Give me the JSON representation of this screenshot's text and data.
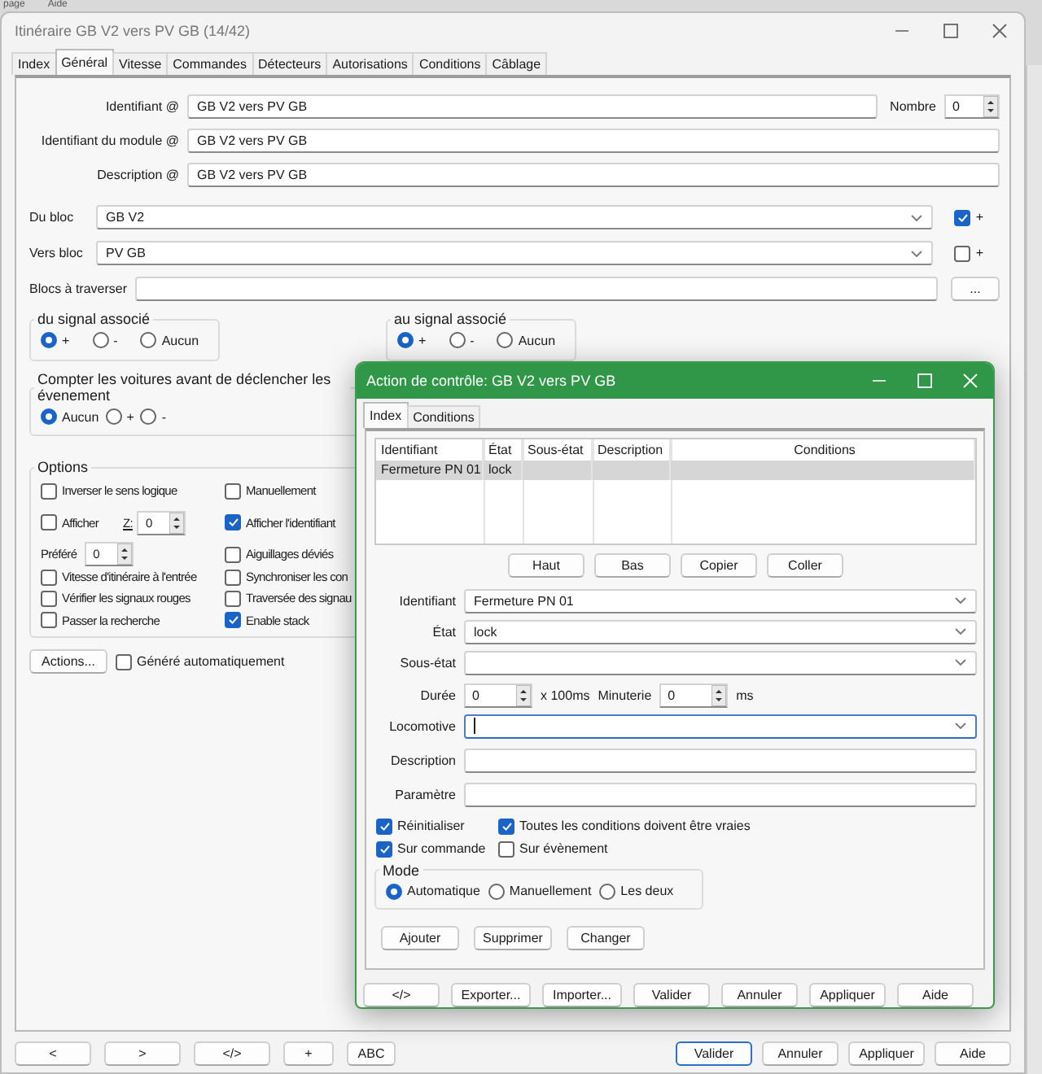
{
  "background_menu": [
    {
      "label": "page"
    },
    {
      "label": "Aide"
    }
  ],
  "window": {
    "title": "Itinéraire GB V2 vers PV GB (14/42)"
  },
  "tabs": [
    {
      "label": "Index",
      "selected": false
    },
    {
      "label": "Général",
      "selected": true
    },
    {
      "label": "Vitesse",
      "selected": false
    },
    {
      "label": "Commandes",
      "selected": false
    },
    {
      "label": "Détecteurs",
      "selected": false
    },
    {
      "label": "Autorisations",
      "selected": false
    },
    {
      "label": "Conditions",
      "selected": false
    },
    {
      "label": "Câblage",
      "selected": false
    }
  ],
  "identity_fields": [
    {
      "label": "Identifiant @",
      "value": "GB V2 vers PV GB"
    },
    {
      "label": "Identifiant du module @",
      "value": "GB V2 vers PV GB"
    },
    {
      "label": "Description @",
      "value": "GB V2 vers PV GB"
    }
  ],
  "nombre": {
    "label": "Nombre",
    "value": "0"
  },
  "block_fields": [
    {
      "label": "Du bloc",
      "value": "GB V2",
      "plus_label": "+",
      "checked": true
    },
    {
      "label": "Vers bloc",
      "value": "PV GB",
      "plus_label": "+",
      "checked": false
    }
  ],
  "blocs_a_traverser": {
    "label": "Blocs à traverser",
    "button": "..."
  },
  "signal_groups": [
    {
      "title": "du signal associé",
      "options": [
        {
          "label": "+",
          "selected": true
        },
        {
          "label": "-",
          "selected": false
        },
        {
          "label": "Aucun",
          "selected": false
        }
      ]
    },
    {
      "title": "au signal associé",
      "options": [
        {
          "label": "+",
          "selected": true
        },
        {
          "label": "-",
          "selected": false
        },
        {
          "label": "Aucun",
          "selected": false
        }
      ]
    }
  ],
  "count_group": {
    "title": "Compter les voitures avant de déclencher les évenement",
    "options": [
      {
        "label": "Aucun",
        "selected": true
      },
      {
        "label": "+",
        "selected": false
      },
      {
        "label": "-",
        "selected": false
      }
    ]
  },
  "options": {
    "title": "Options",
    "items": [
      {
        "kind": "checkbox",
        "label": "Inverser le sens logique",
        "checked": false
      },
      {
        "kind": "checkbox",
        "label": "Manuellement",
        "checked": false
      },
      {
        "kind": "checkbox_spin",
        "label": "Afficher",
        "checked": false,
        "spin_label": "Z:",
        "value": "0"
      },
      {
        "kind": "checkbox",
        "label": "Afficher l'identifiant",
        "checked": true
      },
      {
        "kind": "spin",
        "label": "Préféré",
        "value": "0"
      },
      {
        "kind": "checkbox",
        "label": "Aiguillages déviés",
        "checked": false
      },
      {
        "kind": "checkbox",
        "label": "Vitesse d'itinéraire à l'entrée",
        "checked": false
      },
      {
        "kind": "checkbox",
        "label": "Synchroniser les con",
        "checked": false
      },
      {
        "kind": "checkbox",
        "label": "Vérifier les signaux rouges",
        "checked": false
      },
      {
        "kind": "checkbox",
        "label": "Traversée des signau",
        "checked": false
      },
      {
        "kind": "checkbox",
        "label": "Passer la recherche",
        "checked": false
      },
      {
        "kind": "checkbox",
        "label": "Enable stack",
        "checked": true
      }
    ]
  },
  "actions": {
    "button": "Actions...",
    "auto": {
      "label": "Généré automatiquement",
      "checked": false
    }
  },
  "footer_left": [
    "<",
    ">",
    "</>",
    "+",
    "ABC"
  ],
  "footer_right": [
    {
      "label": "Valider",
      "default": true
    },
    {
      "label": "Annuler",
      "default": false
    },
    {
      "label": "Appliquer",
      "default": false
    },
    {
      "label": "Aide",
      "default": false
    }
  ],
  "dialog": {
    "title": "Action de contrôle: GB V2 vers PV GB",
    "tabs": [
      {
        "label": "Index",
        "selected": true
      },
      {
        "label": "Conditions",
        "selected": false
      }
    ],
    "table": {
      "columns": [
        "Identifiant",
        "État",
        "Sous-état",
        "Description",
        "Conditions"
      ],
      "rows": [
        {
          "cells": [
            "Fermeture PN 01",
            "lock"
          ],
          "selected": true
        }
      ]
    },
    "list_buttons": [
      "Haut",
      "Bas",
      "Copier",
      "Coller"
    ],
    "fields": [
      {
        "kind": "combo",
        "label": "Identifiant",
        "value": "Fermeture PN 01",
        "focused": false
      },
      {
        "kind": "combo",
        "label": "État",
        "value": "lock",
        "focused": false
      },
      {
        "kind": "combo",
        "label": "Sous-état",
        "focused": false
      },
      {
        "kind": "timing",
        "label": "Durée",
        "value": "0",
        "unit": "x 100ms",
        "label2": "Minuterie",
        "value2": "0",
        "unit2": "ms"
      },
      {
        "kind": "combo",
        "label": "Locomotive",
        "focused": true
      },
      {
        "kind": "text",
        "label": "Description"
      },
      {
        "kind": "text",
        "label": "Paramètre"
      }
    ],
    "checks": [
      {
        "label": "Réinitialiser",
        "checked": true
      },
      {
        "label": "Toutes les conditions doivent être vraies",
        "checked": true
      },
      {
        "label": "Sur commande",
        "checked": true
      },
      {
        "label": "Sur évènement",
        "checked": false
      }
    ],
    "mode": {
      "title": "Mode",
      "options": [
        {
          "label": "Automatique",
          "selected": true
        },
        {
          "label": "Manuellement",
          "selected": false
        },
        {
          "label": "Les deux",
          "selected": false
        }
      ]
    },
    "edit_buttons": [
      "Ajouter",
      "Supprimer",
      "Changer"
    ],
    "footer_buttons": [
      "</>",
      "Exporter...",
      "Importer...",
      "Valider",
      "Annuler",
      "Appliquer",
      "Aide"
    ]
  }
}
